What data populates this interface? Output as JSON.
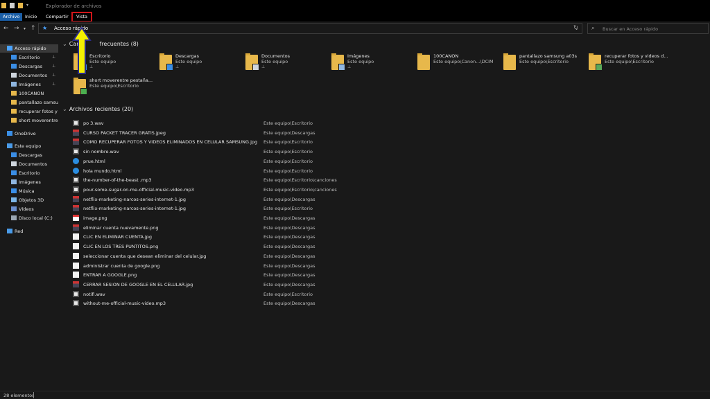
{
  "window": {
    "title": "Explorador de archivos"
  },
  "ribbon": {
    "tabs": [
      "Archivo",
      "Inicio",
      "Compartir",
      "Vista"
    ]
  },
  "address": {
    "path": "Acceso rápido"
  },
  "search": {
    "placeholder": "Buscar en Acceso rápido"
  },
  "sidebar": {
    "items": [
      {
        "label": "Acceso rápido",
        "icon": "star-icon",
        "pinned": false
      },
      {
        "label": "Escritorio",
        "icon": "desktop-icon",
        "pinned": true
      },
      {
        "label": "Descargas",
        "icon": "download-icon",
        "pinned": true
      },
      {
        "label": "Documentos",
        "icon": "documents-icon",
        "pinned": true
      },
      {
        "label": "Imágenes",
        "icon": "pictures-icon",
        "pinned": true
      },
      {
        "label": "100CANON",
        "icon": "folder-icon",
        "pinned": false
      },
      {
        "label": "pantallazo samsung",
        "icon": "folder-icon",
        "pinned": false
      },
      {
        "label": "recuperar fotos y vi",
        "icon": "folder-icon",
        "pinned": false
      },
      {
        "label": "short moverentre p",
        "icon": "folder-icon",
        "pinned": false
      },
      {
        "label": "OneDrive",
        "icon": "cloud-icon",
        "pinned": false
      },
      {
        "label": "Este equipo",
        "icon": "computer-icon",
        "pinned": false
      },
      {
        "label": "Descargas",
        "icon": "download-icon",
        "pinned": false
      },
      {
        "label": "Documentos",
        "icon": "documents-icon",
        "pinned": false
      },
      {
        "label": "Escritorio",
        "icon": "desktop-icon",
        "pinned": false
      },
      {
        "label": "Imágenes",
        "icon": "pictures-icon",
        "pinned": false
      },
      {
        "label": "Música",
        "icon": "music-icon",
        "pinned": false
      },
      {
        "label": "Objetos 3D",
        "icon": "cube-icon",
        "pinned": false
      },
      {
        "label": "Vídeos",
        "icon": "video-icon",
        "pinned": false
      },
      {
        "label": "Disco local (C:)",
        "icon": "drive-icon",
        "pinned": false
      },
      {
        "label": "Red",
        "icon": "network-icon",
        "pinned": false
      }
    ]
  },
  "frequent": {
    "heading": "Carpetas frecuentes (8)",
    "heading_visible_start": "Car",
    "heading_visible_end": "frecuentes (8)",
    "folders": [
      {
        "name": "Escritorio",
        "location": "Este equipo",
        "pinned": true
      },
      {
        "name": "Descargas",
        "location": "Este equipo",
        "pinned": true
      },
      {
        "name": "Documentos",
        "location": "Este equipo",
        "pinned": true
      },
      {
        "name": "Imágenes",
        "location": "Este equipo",
        "pinned": true
      },
      {
        "name": "100CANON",
        "location": "Este equipo\\Canon...\\DCIM",
        "pinned": false
      },
      {
        "name": "pantallazo samsung a03s",
        "location": "Este equipo\\Escritorio",
        "pinned": false
      },
      {
        "name": "recuperar fotos y videos d...",
        "location": "Este equipo\\Escritorio",
        "pinned": false
      },
      {
        "name": "short moverentre pestaña...",
        "location": "Este equipo\\Escritorio",
        "pinned": false
      }
    ]
  },
  "recent": {
    "heading": "Archivos recientes (20)",
    "files": [
      {
        "name": "po 3.wav",
        "path": "Este equipo\\Escritorio",
        "icon": "audio-file-icon"
      },
      {
        "name": "CURSO PACKET TRACER GRATIS.jpeg",
        "path": "Este equipo\\Descargas",
        "icon": "image-file-icon"
      },
      {
        "name": "COMO RECUPERAR FOTOS Y VIDEOS ELIMINADOS EN CELULAR SAMSUNG.jpg",
        "path": "Este equipo\\Escritorio",
        "icon": "image-file-icon"
      },
      {
        "name": "sin nombre.wav",
        "path": "Este equipo\\Escritorio",
        "icon": "audio-file-icon"
      },
      {
        "name": "prue.html",
        "path": "Este equipo\\Escritorio",
        "icon": "edge-file-icon"
      },
      {
        "name": "hola mundo.html",
        "path": "Este equipo\\Escritorio",
        "icon": "edge-file-icon"
      },
      {
        "name": "the-number-of-the-beast .mp3",
        "path": "Este equipo\\Escritorio\\canciones",
        "icon": "audio-file-icon"
      },
      {
        "name": "pour-some-sugar-on-me-official-music-video.mp3",
        "path": "Este equipo\\Escritorio\\canciones",
        "icon": "audio-file-icon"
      },
      {
        "name": "netflix-marketing-narcos-series-internet-1.jpg",
        "path": "Este equipo\\Descargas",
        "icon": "image-file-icon"
      },
      {
        "name": "netflix-marketing-narcos-series-internet-1.jpg",
        "path": "Este equipo\\Escritorio",
        "icon": "image-file-icon"
      },
      {
        "name": "image.png",
        "path": "Este equipo\\Descargas",
        "icon": "gmail-file-icon"
      },
      {
        "name": "eliminar cuenta nuevamente.png",
        "path": "Este equipo\\Descargas",
        "icon": "image-file-icon"
      },
      {
        "name": "CLIC EN ELIMINAR CUENTA.jpg",
        "path": "Este equipo\\Descargas",
        "icon": "blank-file-icon"
      },
      {
        "name": "CLIC EN LOS TRES PUNTITOS.png",
        "path": "Este equipo\\Descargas",
        "icon": "blank-file-icon"
      },
      {
        "name": "seleccionar cuenta que desean eliminar del celular.jpg",
        "path": "Este equipo\\Descargas",
        "icon": "blank-file-icon"
      },
      {
        "name": "administrar cuenta de google.png",
        "path": "Este equipo\\Descargas",
        "icon": "blank-file-icon"
      },
      {
        "name": "ENTRAR A GOOGLE.png",
        "path": "Este equipo\\Descargas",
        "icon": "blank-file-icon"
      },
      {
        "name": "CERRAR SESION DE GOOGLE EN EL CELULAR.jpg",
        "path": "Este equipo\\Descargas",
        "icon": "image-file-icon"
      },
      {
        "name": "notifi.wav",
        "path": "Este equipo\\Escritorio",
        "icon": "audio-file-icon"
      },
      {
        "name": "without-me-official-music-video.mp3",
        "path": "Este equipo\\Descargas",
        "icon": "audio-file-icon"
      }
    ]
  },
  "status": {
    "count": "28 elementos"
  },
  "colors": {
    "ribbon_active": "#1b5fa8",
    "highlight": "#d0161a",
    "arrow": "#f4f000",
    "folder": "#e7b84b"
  }
}
